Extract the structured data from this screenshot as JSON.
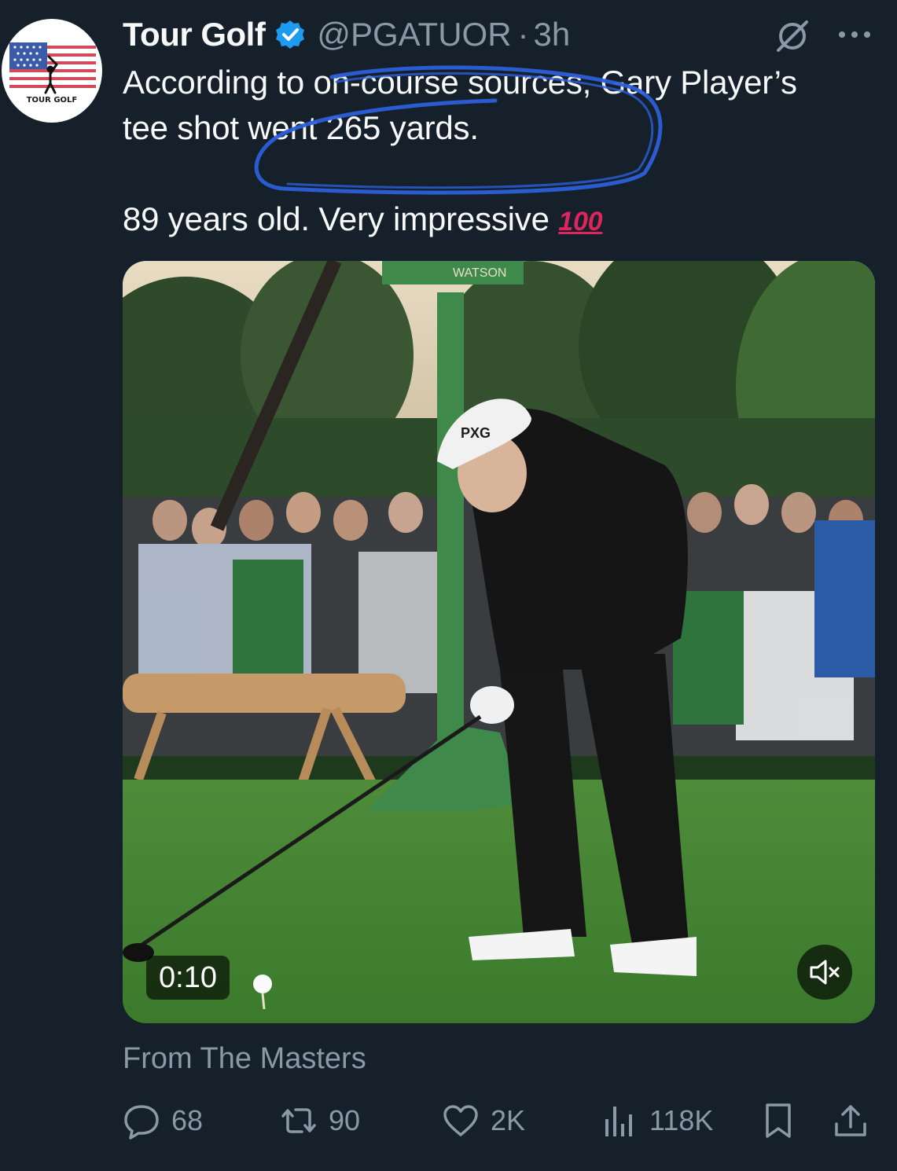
{
  "tweet": {
    "display_name": "Tour Golf",
    "handle": "@PGATUOR",
    "separator": "·",
    "time": "3h",
    "avatar_text": "TOUR GOLF",
    "line1": "According to on-course sources, Gary Player’s",
    "line2": "tee shot went 265 yards.",
    "line3": "89 years old. Very impressive",
    "emoji": "100",
    "video_sign_text": "WATSON",
    "cap_logo": "PXG",
    "video_timer": "0:10",
    "source_label": "From The Masters"
  },
  "actions": {
    "replies": "68",
    "reposts": "90",
    "likes": "2K",
    "views": "118K"
  },
  "icons": {
    "verified": "verified-badge-icon",
    "grok": "grok-icon",
    "more": "more-icon",
    "reply": "reply-icon",
    "repost": "repost-icon",
    "like": "like-icon",
    "views": "views-icon",
    "bookmark": "bookmark-icon",
    "share": "share-icon",
    "mute": "muted-speaker-icon"
  },
  "colors": {
    "background": "#15202b",
    "text": "#f7f9f9",
    "muted_text": "#8b98a5",
    "verified_blue": "#1d9bf0",
    "annotation_blue": "#2b5fd9"
  }
}
